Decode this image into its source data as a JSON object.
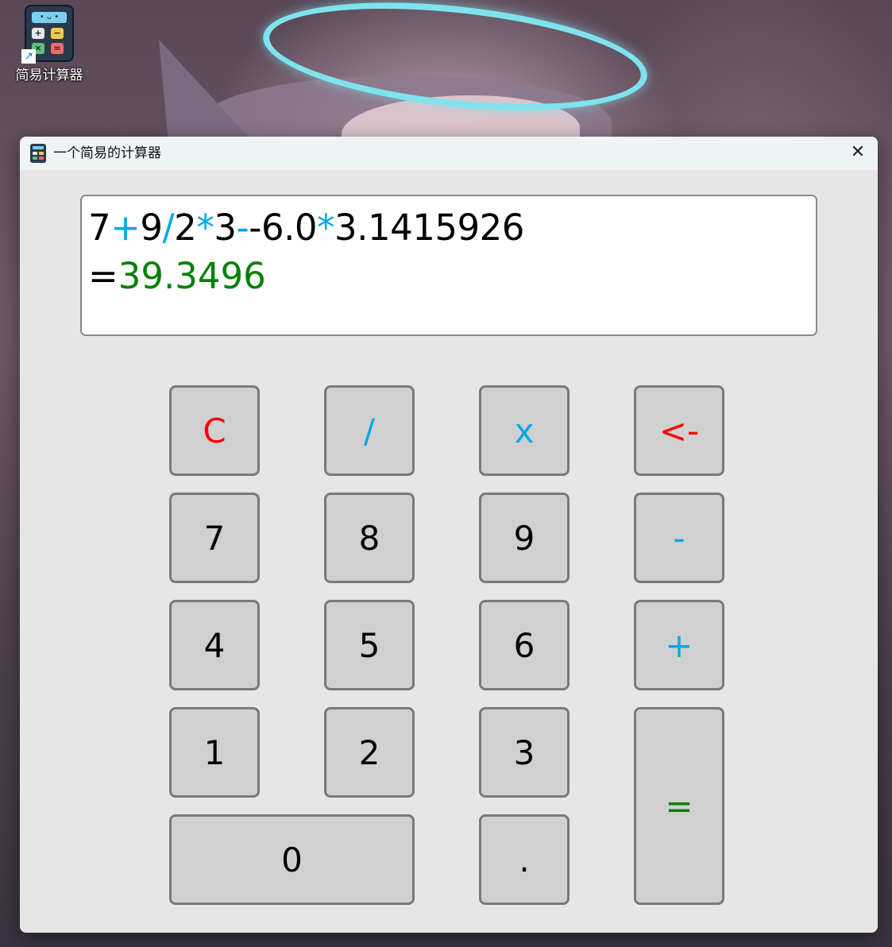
{
  "desktop": {
    "shortcut_label": "简易计算器",
    "shortcut_screen_glyph": "• ᴗ •",
    "shortcut_keys": [
      "+",
      "−",
      "×",
      "="
    ]
  },
  "window": {
    "title": "一个简易的计算器",
    "close_glyph": "✕"
  },
  "display": {
    "expression_tokens": [
      {
        "text": "7",
        "color": "#000000"
      },
      {
        "text": "+",
        "color": "#00a8e8"
      },
      {
        "text": "9",
        "color": "#000000"
      },
      {
        "text": "/",
        "color": "#00a8e8"
      },
      {
        "text": "2",
        "color": "#000000"
      },
      {
        "text": "*",
        "color": "#00a8e8"
      },
      {
        "text": "3",
        "color": "#000000"
      },
      {
        "text": "-",
        "color": "#00a8e8"
      },
      {
        "text": "-6.0",
        "color": "#000000"
      },
      {
        "text": "*",
        "color": "#00a8e8"
      },
      {
        "text": "3.1415926",
        "color": "#000000"
      }
    ],
    "equals_sign": "=",
    "result": "39.3496",
    "result_color": "#008000"
  },
  "keys": {
    "clear": "C",
    "divide": "/",
    "multiply": "x",
    "backspace": "<-",
    "seven": "7",
    "eight": "8",
    "nine": "9",
    "minus": "-",
    "four": "4",
    "five": "5",
    "six": "6",
    "plus": "+",
    "one": "1",
    "two": "2",
    "three": "3",
    "equals": "=",
    "zero": "0",
    "decimal": "."
  },
  "colors": {
    "clear_key": "#ff0000",
    "backspace_key": "#ff0000",
    "operator_key": "#00a8e8",
    "equals_key": "#008000",
    "digit_key": "#000000"
  }
}
